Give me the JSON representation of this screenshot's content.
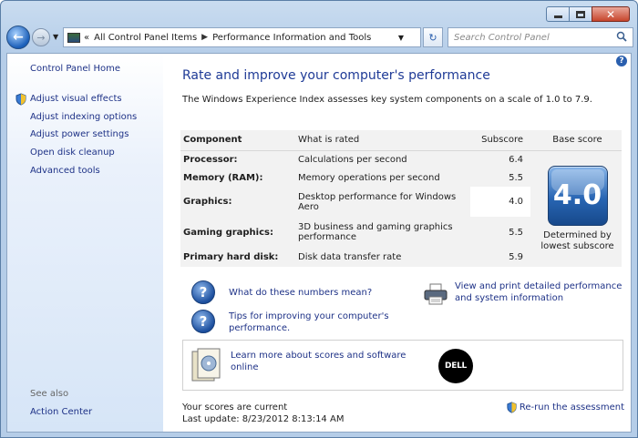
{
  "window": {
    "caption_buttons": [
      "minimize",
      "maximize",
      "close"
    ]
  },
  "nav": {
    "breadcrumb": [
      "All Control Panel Items",
      "Performance Information and Tools"
    ],
    "breadcrumb_prefix": "«",
    "search_placeholder": "Search Control Panel"
  },
  "sidebar": {
    "home": "Control Panel Home",
    "items": [
      {
        "label": "Adjust visual effects",
        "icon": "shield-icon"
      },
      {
        "label": "Adjust indexing options"
      },
      {
        "label": "Adjust power settings"
      },
      {
        "label": "Open disk cleanup"
      },
      {
        "label": "Advanced tools"
      }
    ],
    "see_also": "See also",
    "action_center": "Action Center"
  },
  "main": {
    "title": "Rate and improve your computer's performance",
    "subtitle": "The Windows Experience Index assesses key system components on a scale of 1.0 to 7.9.",
    "table": {
      "headers": [
        "Component",
        "What is rated",
        "Subscore",
        "Base score"
      ],
      "rows": [
        {
          "component": "Processor:",
          "rated": "Calculations per second",
          "subscore": "6.4"
        },
        {
          "component": "Memory (RAM):",
          "rated": "Memory operations per second",
          "subscore": "5.5"
        },
        {
          "component": "Graphics:",
          "rated": "Desktop performance for Windows Aero",
          "subscore": "4.0"
        },
        {
          "component": "Gaming graphics:",
          "rated": "3D business and gaming graphics performance",
          "subscore": "5.5"
        },
        {
          "component": "Primary hard disk:",
          "rated": "Disk data transfer rate",
          "subscore": "5.9"
        }
      ],
      "base_score": "4.0",
      "base_caption": "Determined by lowest subscore"
    },
    "links": {
      "numbers": "What do these numbers mean?",
      "tips": "Tips for improving your computer's performance.",
      "print": "View and print detailed performance and system information",
      "learn": "Learn more about scores and software online"
    },
    "dell_logo": "DELL",
    "status_current": "Your scores are current",
    "status_update": "Last update: 8/23/2012 8:13:14 AM",
    "rerun": "Re-run the assessment"
  }
}
